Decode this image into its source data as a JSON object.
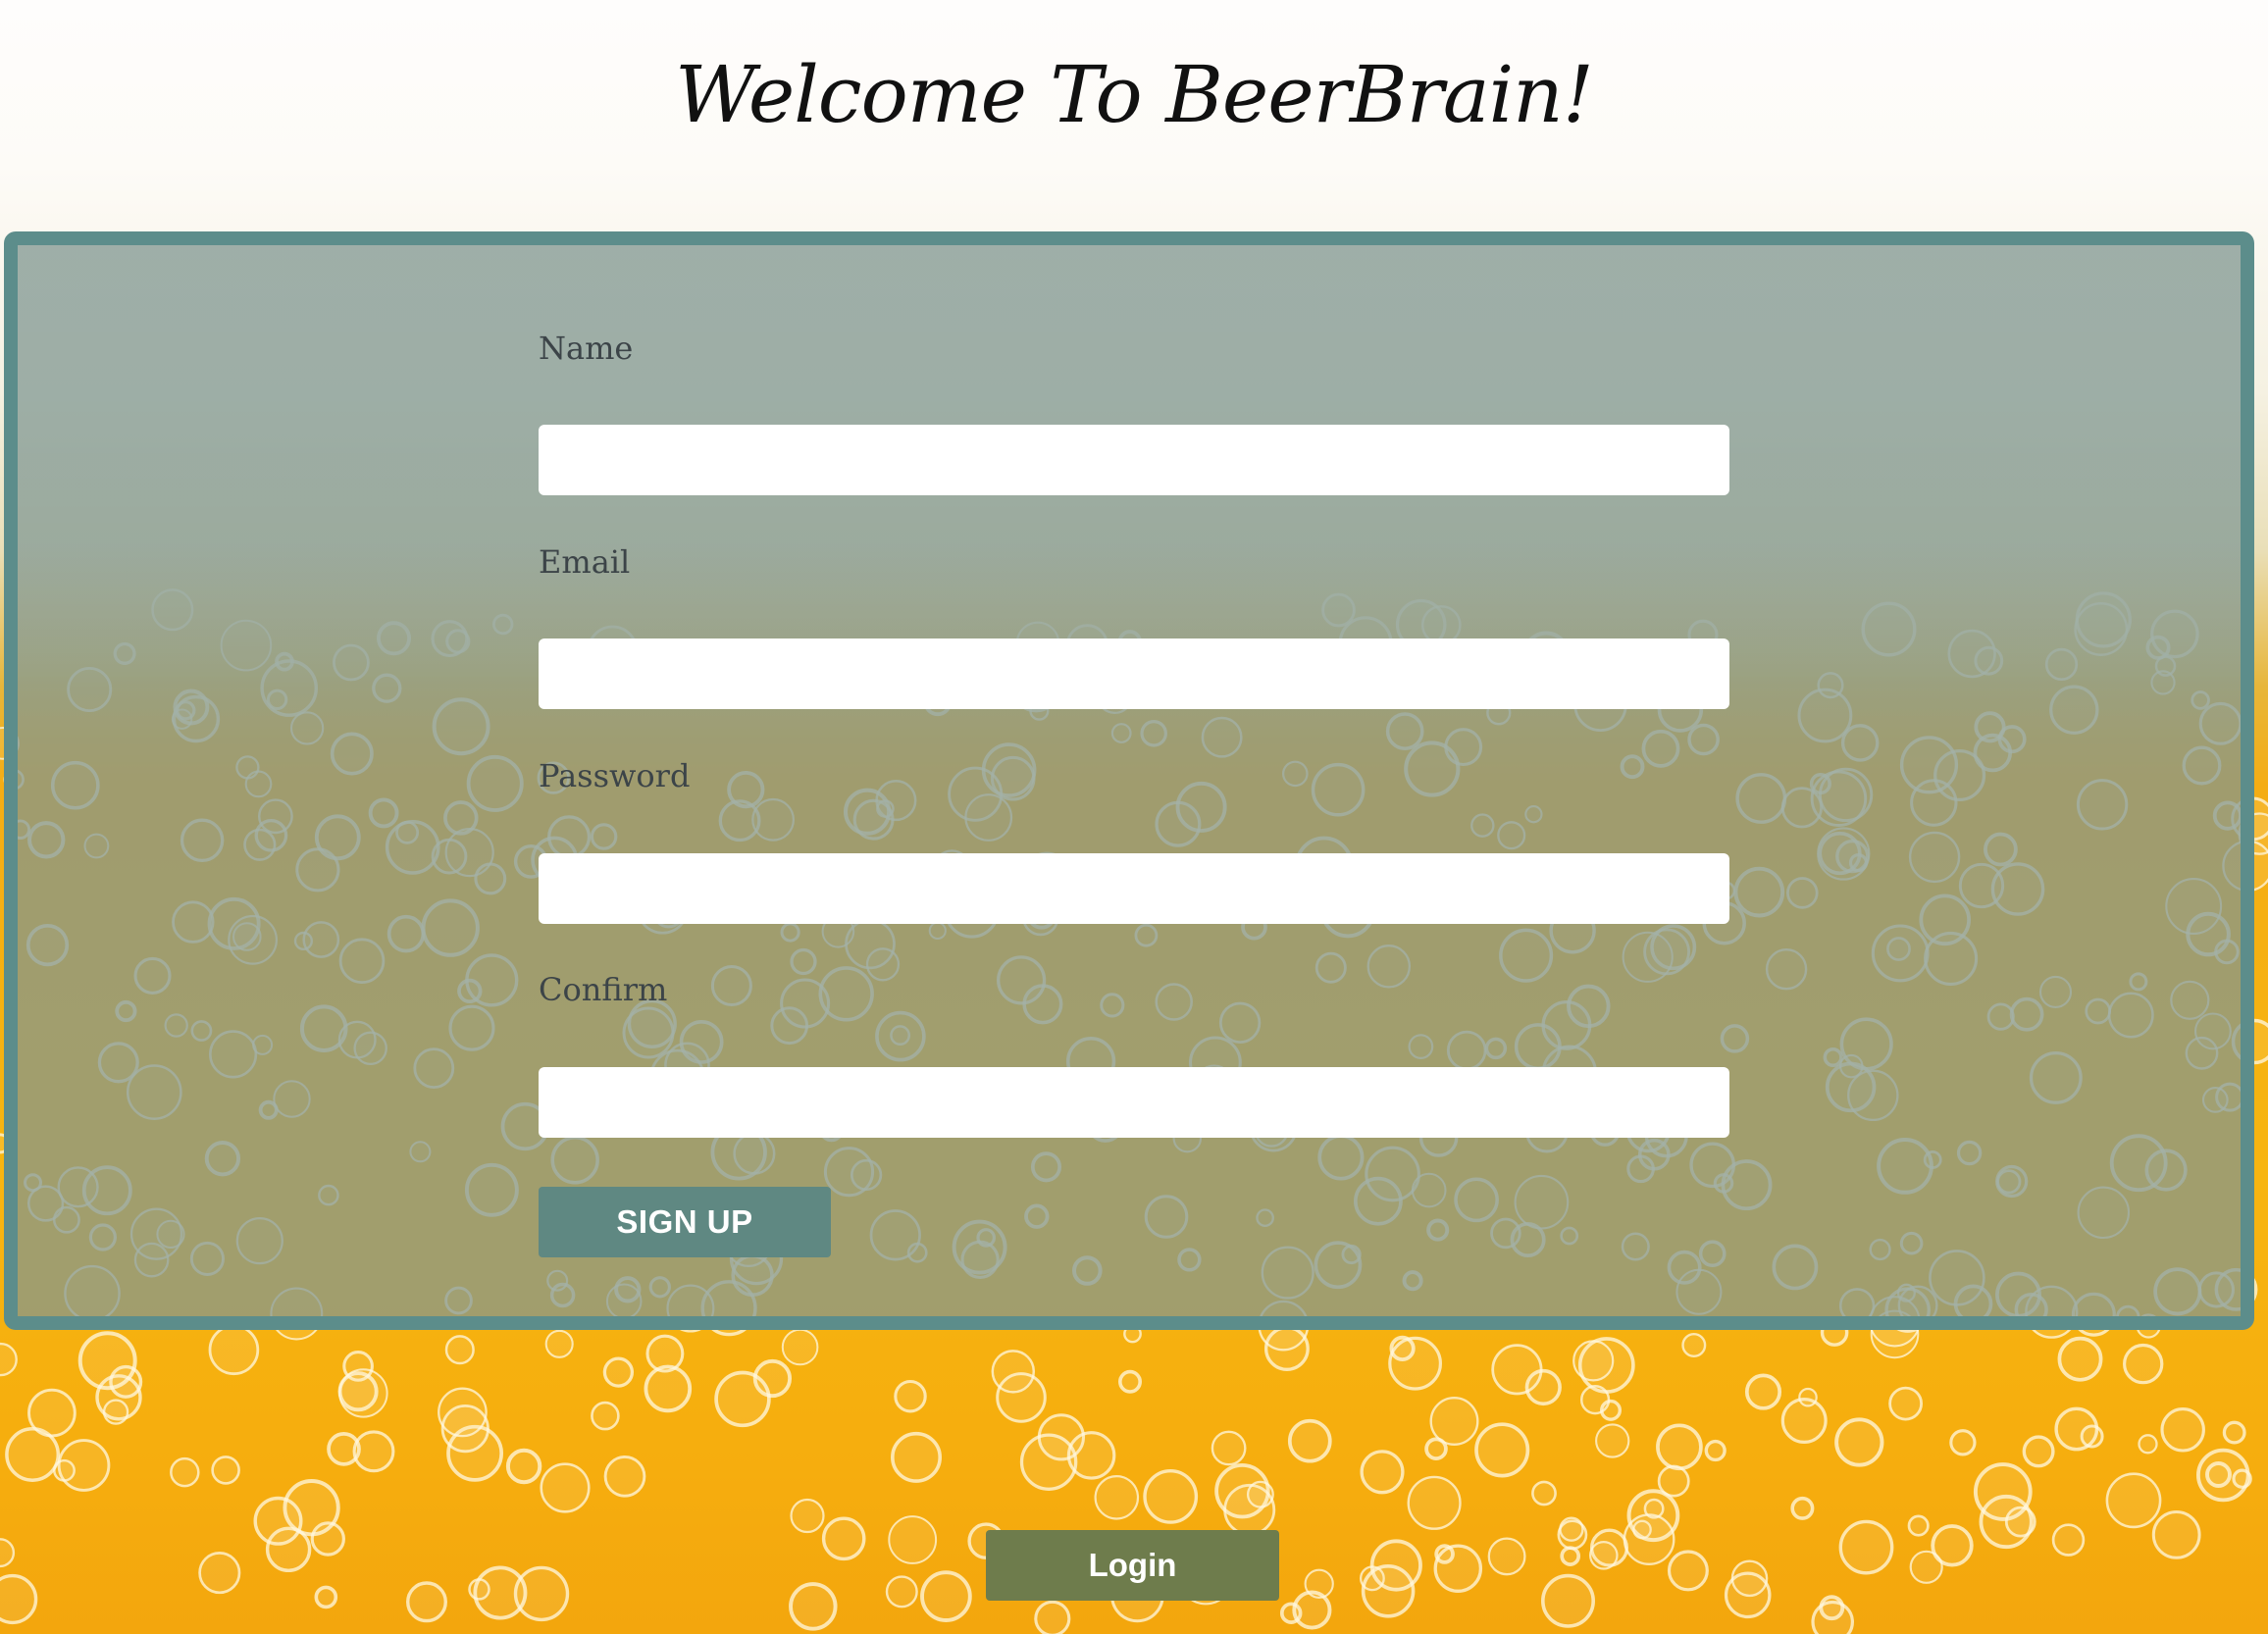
{
  "page": {
    "title": "Welcome To BeerBrain!"
  },
  "signup_form": {
    "fields": [
      {
        "label": "Name",
        "value": "",
        "placeholder": ""
      },
      {
        "label": "Email",
        "value": "",
        "placeholder": ""
      },
      {
        "label": "Password",
        "value": "",
        "placeholder": ""
      },
      {
        "label": "Confirm",
        "value": "",
        "placeholder": ""
      }
    ],
    "submit_label": "SIGN UP"
  },
  "login_label": "Login",
  "colors": {
    "panel_border": "#5c8d8b",
    "signup_button": "#5f8882",
    "login_button": "#6e7c4c",
    "beer": "#f7b510"
  }
}
